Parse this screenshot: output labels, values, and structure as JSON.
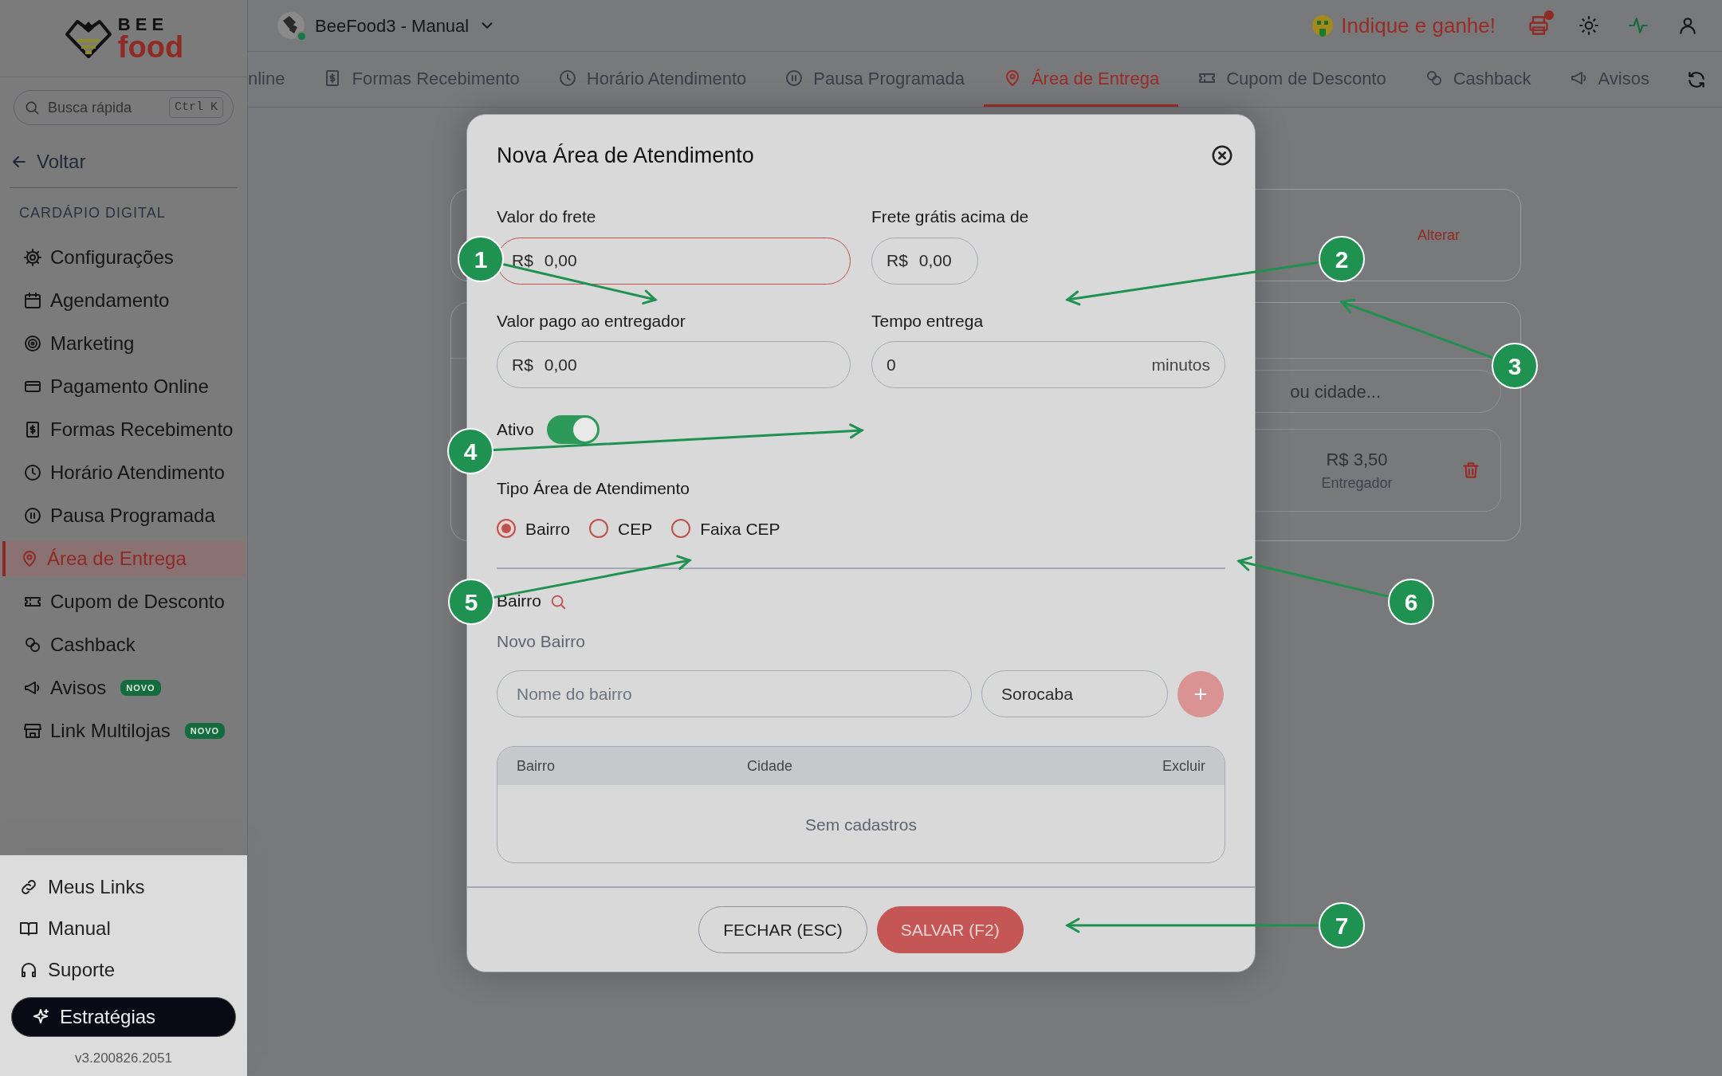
{
  "sidebar": {
    "brand_top": "BEE",
    "brand_bottom": "food",
    "search": {
      "placeholder": "Busca rápida",
      "shortcut": "Ctrl K"
    },
    "back": "Voltar",
    "section": "CARDÁPIO DIGITAL",
    "items": [
      {
        "label": "Configurações",
        "selected": false
      },
      {
        "label": "Agendamento",
        "selected": false
      },
      {
        "label": "Marketing",
        "selected": false
      },
      {
        "label": "Pagamento Online",
        "selected": false
      },
      {
        "label": "Formas Recebimento",
        "selected": false
      },
      {
        "label": "Horário Atendimento",
        "selected": false
      },
      {
        "label": "Pausa Programada",
        "selected": false
      },
      {
        "label": "Área de Entrega",
        "selected": true
      },
      {
        "label": "Cupom de Desconto",
        "selected": false
      },
      {
        "label": "Cashback",
        "selected": false
      },
      {
        "label": "Avisos",
        "selected": false,
        "badge": "NOVO"
      },
      {
        "label": "Link Multilojas",
        "selected": false,
        "badge": "NOVO"
      }
    ],
    "footer_links": [
      {
        "label": "Meus Links"
      },
      {
        "label": "Manual"
      },
      {
        "label": "Suporte"
      }
    ],
    "cta": "Estratégias",
    "version": "v3.200826.2051"
  },
  "topbar": {
    "store": "BeeFood3 - Manual",
    "online": true,
    "referral": "Indique e ganhe!",
    "printer_alert": true
  },
  "tabs": [
    {
      "label": "nline",
      "selected": false
    },
    {
      "label": "Formas Recebimento",
      "selected": false
    },
    {
      "label": "Horário Atendimento",
      "selected": false
    },
    {
      "label": "Pausa Programada",
      "selected": false
    },
    {
      "label": "Área de Entrega",
      "selected": true
    },
    {
      "label": "Cupom de Desconto",
      "selected": false
    },
    {
      "label": "Cashback",
      "selected": false
    },
    {
      "label": "Avisos",
      "selected": false
    }
  ],
  "page": {
    "delivery_type": {
      "action": "Alterar"
    },
    "zones": {
      "search_placeholder": "ou cidade...",
      "rows": [
        {
          "stats": [
            {
              "value": "R$ 3,50",
              "label": "Entregador"
            }
          ]
        }
      ]
    }
  },
  "modal": {
    "title": "Nova Área de Atendimento",
    "fields": [
      {
        "label": "Valor do frete",
        "prefix": "R$",
        "value": "0,00",
        "focused": true
      },
      {
        "label": "Frete grátis acima de",
        "prefix": "R$",
        "value": "0,00",
        "focused": false
      },
      {
        "label": "Valor pago ao entregador",
        "prefix": "R$",
        "value": "0,00",
        "focused": false
      },
      {
        "label": "Tempo entrega",
        "value": "0",
        "suffix": "minutos",
        "focused": false
      }
    ],
    "active": {
      "label": "Ativo",
      "on": true
    },
    "area_type": {
      "label": "Tipo Área de Atendimento",
      "options": [
        {
          "label": "Bairro",
          "selected": true
        },
        {
          "label": "CEP",
          "selected": false
        },
        {
          "label": "Faixa CEP",
          "selected": false
        }
      ]
    },
    "section": {
      "title": "Bairro",
      "subtitle": "Novo Bairro",
      "name_placeholder": "Nome do bairro",
      "city": "Sorocaba",
      "add_disabled": true
    },
    "table": {
      "columns": [
        "Bairro",
        "Cidade",
        "Excluir"
      ],
      "empty": "Sem cadastros"
    },
    "buttons": [
      {
        "label": "FECHAR (ESC)",
        "kind": "secondary"
      },
      {
        "label": "SALVAR (F2)",
        "kind": "primary"
      }
    ]
  },
  "callouts": [
    {
      "label": "1"
    },
    {
      "label": "2"
    },
    {
      "label": "3"
    },
    {
      "label": "4"
    },
    {
      "label": "5"
    },
    {
      "label": "6"
    },
    {
      "label": "7"
    }
  ]
}
